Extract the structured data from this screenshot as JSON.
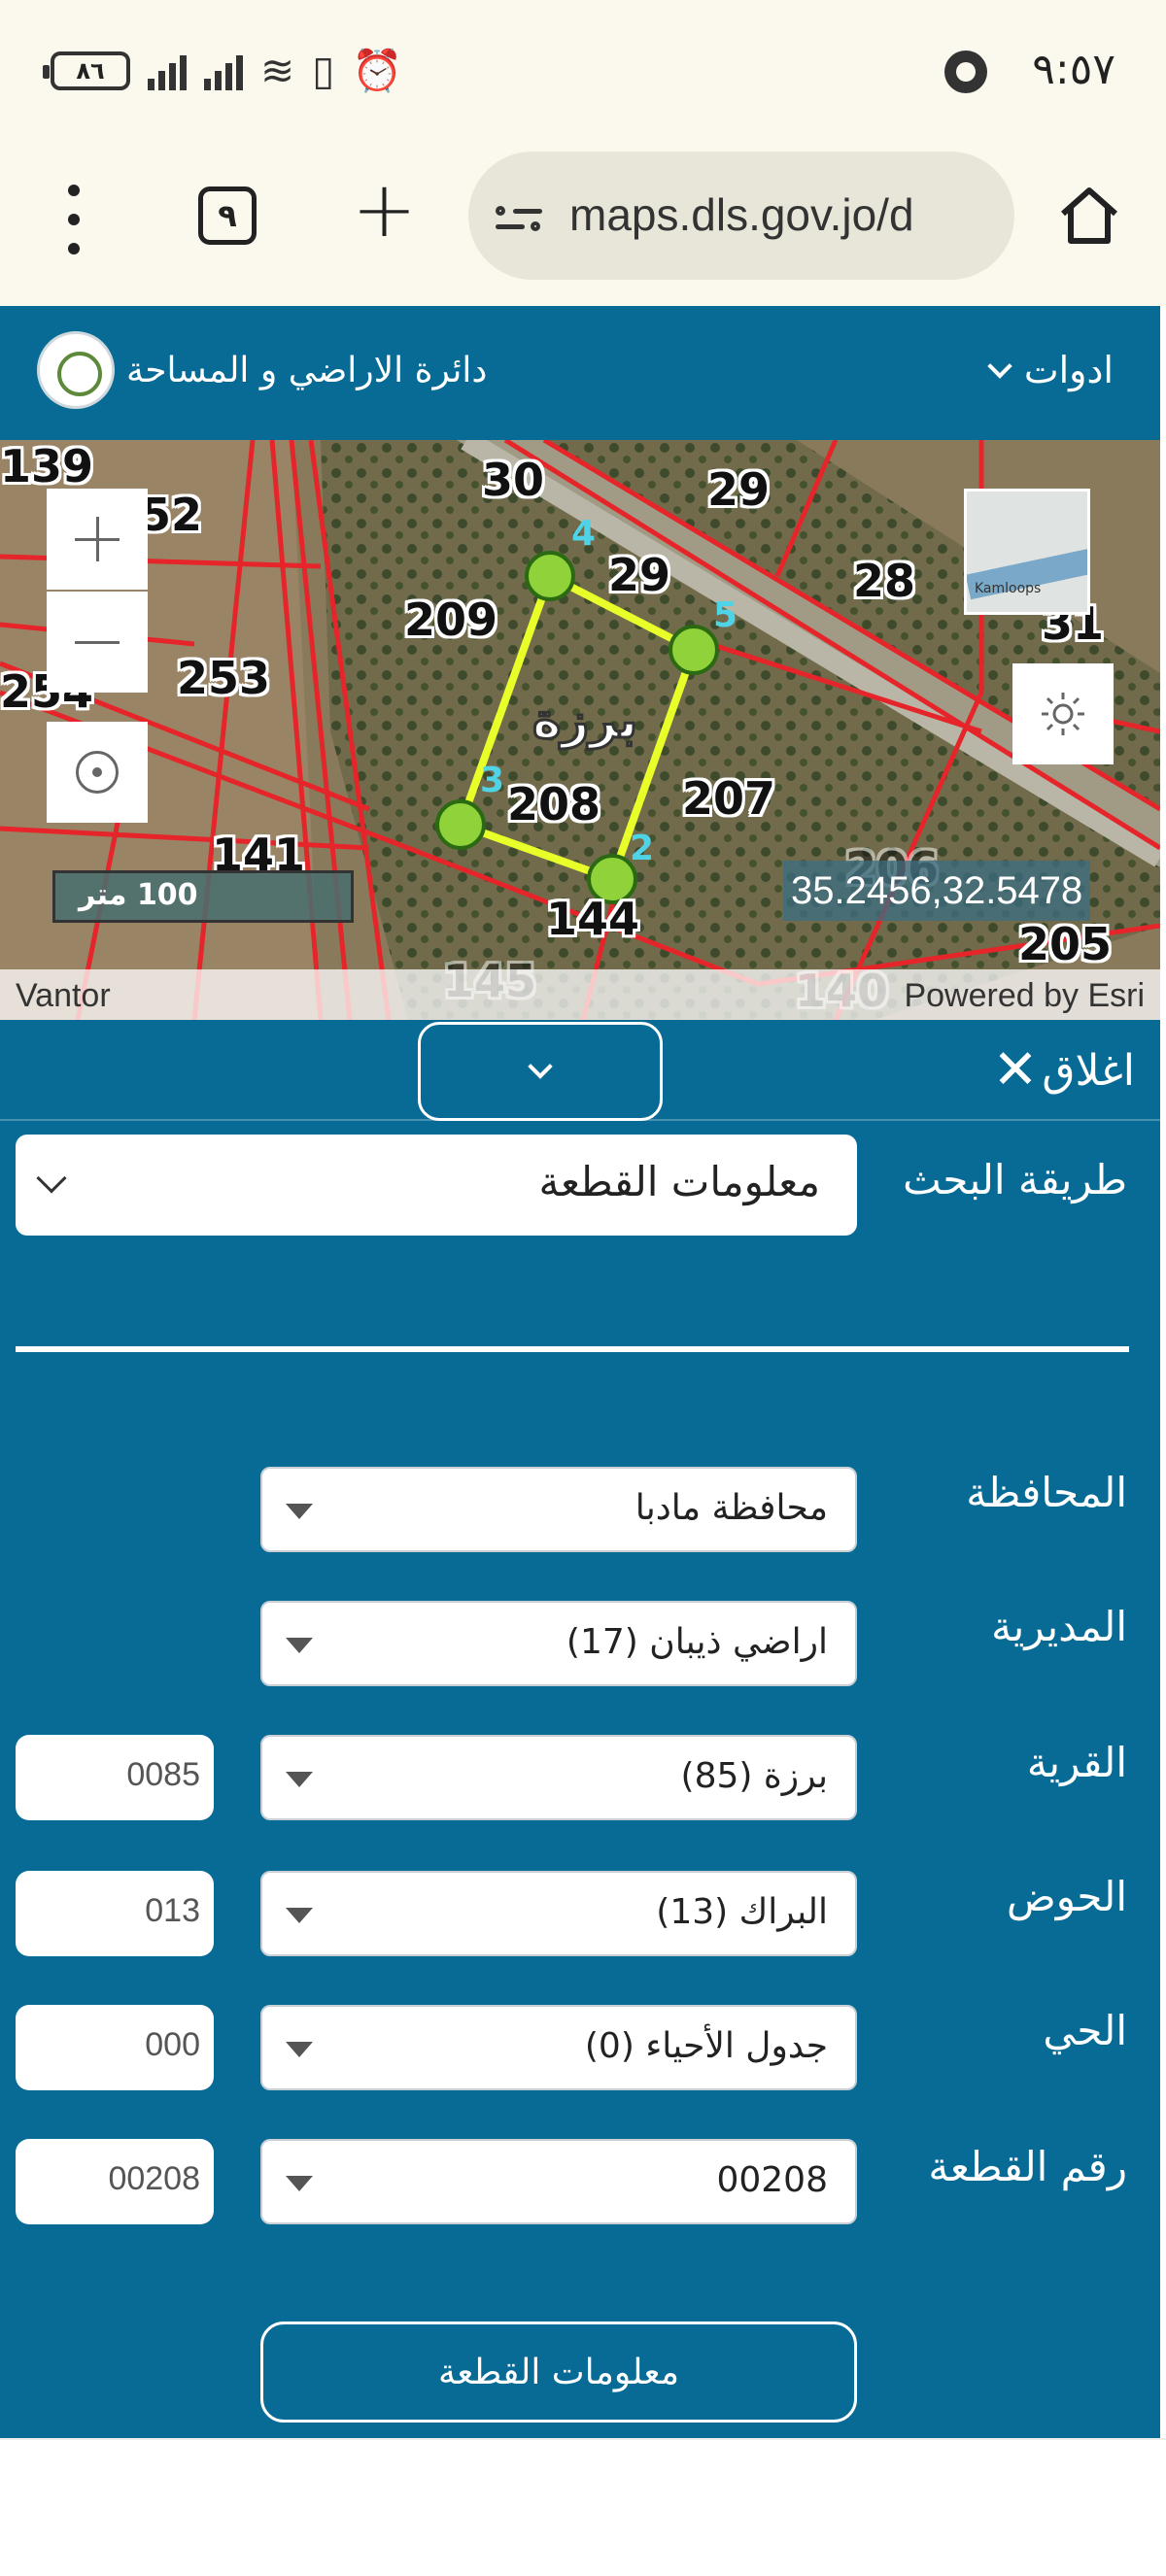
{
  "status_bar": {
    "time": "٩:٥٧",
    "battery": "٨٦"
  },
  "browser": {
    "tab_count": "٩",
    "url": "maps.dls.gov.jo/d"
  },
  "header": {
    "org_name": "دائرة الاراضي و المساحة",
    "tools_label": "ادوات"
  },
  "map": {
    "plot_numbers": [
      "139",
      "52",
      "30",
      "29",
      "29",
      "28",
      "209",
      "31",
      "253",
      "254",
      "208",
      "207",
      "141",
      "144",
      "206",
      "205",
      "145",
      "140"
    ],
    "vertex_labels": [
      "4",
      "5",
      "3",
      "2"
    ],
    "village_label": "برزة",
    "scale_label": "100 متر",
    "coordinates": "35.2456,32.5478",
    "attribution_left": "Vantor",
    "attribution_right": "Powered by Esri",
    "basemap_thumb_label": "Kamloops"
  },
  "panel": {
    "close_label": "اغلاق",
    "search_method_label": "طريقة البحث",
    "search_method_value": "معلومات القطعة",
    "fields": [
      {
        "label": "المحافظة",
        "value": "محافظة مادبا",
        "code": ""
      },
      {
        "label": "المديرية",
        "value": "اراضي ذيبان (17)",
        "code": ""
      },
      {
        "label": "القرية",
        "value": "برزة (85)",
        "code": "0085"
      },
      {
        "label": "الحوض",
        "value": "البراك (13)",
        "code": "013"
      },
      {
        "label": "الحي",
        "value": "جدول الأحياء (0)",
        "code": "000"
      },
      {
        "label": "رقم القطعة",
        "value": "00208",
        "code": "00208"
      }
    ],
    "submit_label": "معلومات القطعة"
  },
  "colors": {
    "primary": "#086b96",
    "parcel_outline": "#e8ff2a",
    "boundary": "#e5252a"
  }
}
